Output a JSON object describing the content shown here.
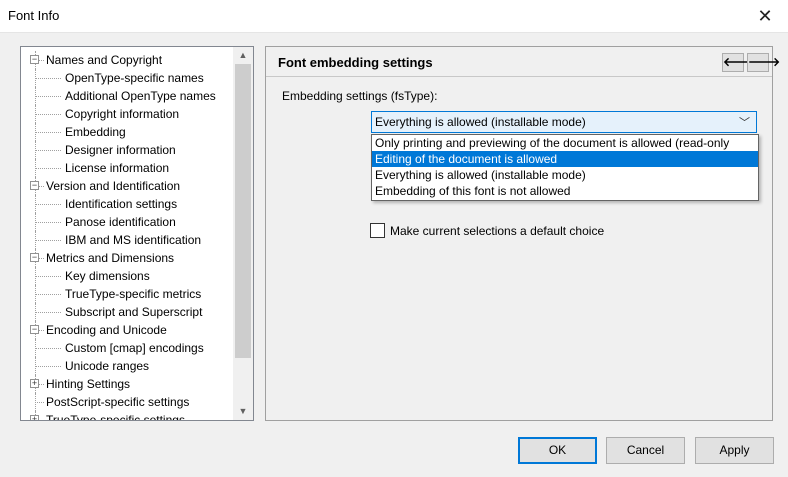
{
  "window": {
    "title": "Font Info"
  },
  "icons": {
    "close": "close-icon",
    "expand_minus": "collapse-icon",
    "expand_plus": "expand-icon"
  },
  "tree": {
    "items": [
      {
        "label": "Names and Copyright",
        "level": 0,
        "expander": "−"
      },
      {
        "label": "OpenType-specific names",
        "level": 1
      },
      {
        "label": "Additional OpenType names",
        "level": 1
      },
      {
        "label": "Copyright information",
        "level": 1
      },
      {
        "label": "Embedding",
        "level": 1
      },
      {
        "label": "Designer information",
        "level": 1
      },
      {
        "label": "License information",
        "level": 1
      },
      {
        "label": "Version and Identification",
        "level": 0,
        "expander": "−"
      },
      {
        "label": "Identification settings",
        "level": 1
      },
      {
        "label": "Panose identification",
        "level": 1
      },
      {
        "label": "IBM and MS identification",
        "level": 1
      },
      {
        "label": "Metrics and Dimensions",
        "level": 0,
        "expander": "−"
      },
      {
        "label": "Key dimensions",
        "level": 1
      },
      {
        "label": "TrueType-specific metrics",
        "level": 1
      },
      {
        "label": "Subscript and Superscript",
        "level": 1
      },
      {
        "label": "Encoding and Unicode",
        "level": 0,
        "expander": "−"
      },
      {
        "label": "Custom [cmap] encodings",
        "level": 1
      },
      {
        "label": "Unicode ranges",
        "level": 1
      },
      {
        "label": "Hinting Settings",
        "level": 0,
        "expander": "+"
      },
      {
        "label": "PostScript-specific settings",
        "level": 0
      },
      {
        "label": "TrueType-specific settings",
        "level": 0,
        "expander": "+"
      }
    ]
  },
  "panel": {
    "title": "Font embedding settings",
    "prev_glyph": "🡐",
    "next_glyph": "🡒",
    "embedding_label": "Embedding settings (fsType):",
    "combo_value": "Everything is allowed (installable mode)",
    "options": [
      "Only printing and previewing of the document is allowed (read-only",
      "Editing of the document is allowed",
      "Everything is allowed (installable mode)",
      "Embedding of this font is not allowed"
    ],
    "highlighted_option_index": 1,
    "checkbox_label": "Make current selections a default choice",
    "checkbox_checked": false
  },
  "buttons": {
    "ok": "OK",
    "cancel": "Cancel",
    "apply": "Apply"
  },
  "colors": {
    "accent": "#0078d7",
    "selection_bg": "#0078d7"
  }
}
